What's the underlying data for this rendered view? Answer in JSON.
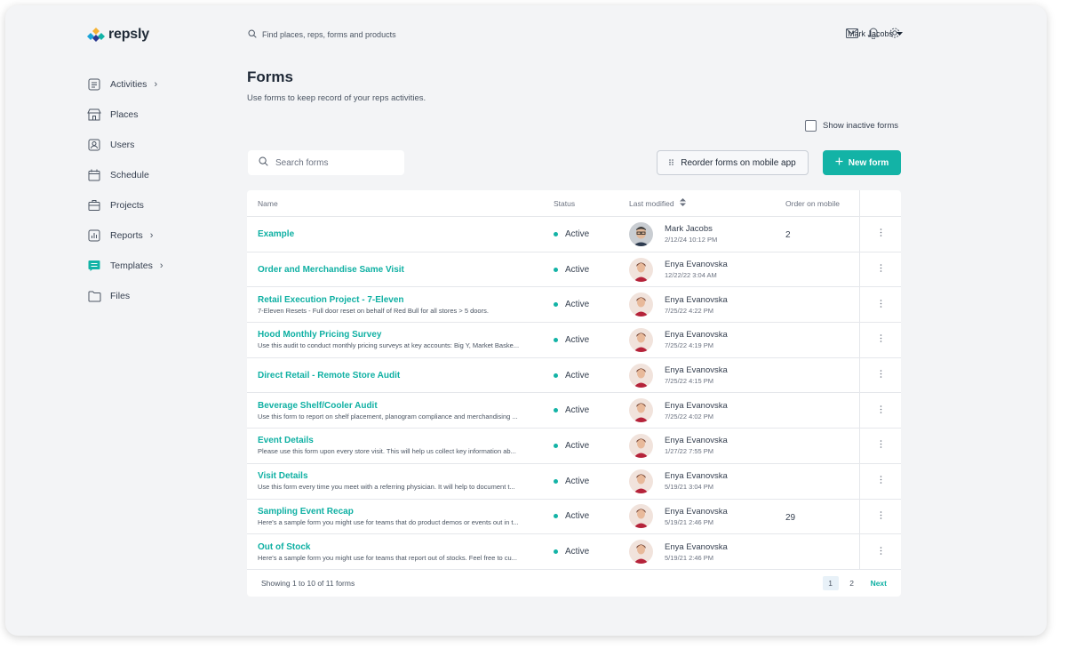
{
  "brand": {
    "name": "repsly"
  },
  "topbar": {
    "search_placeholder": "Find places, reps, forms and products",
    "user_name": "Mark Jacobs",
    "icons": [
      "mail-icon",
      "bell-icon",
      "gear-icon"
    ]
  },
  "sidebar": {
    "items": [
      {
        "label": "Activities",
        "icon": "activities-icon",
        "has_chevron": true
      },
      {
        "label": "Places",
        "icon": "store-icon",
        "has_chevron": false
      },
      {
        "label": "Users",
        "icon": "user-icon",
        "has_chevron": false
      },
      {
        "label": "Schedule",
        "icon": "calendar-icon",
        "has_chevron": false
      },
      {
        "label": "Projects",
        "icon": "briefcase-icon",
        "has_chevron": false
      },
      {
        "label": "Reports",
        "icon": "report-icon",
        "has_chevron": true
      },
      {
        "label": "Templates",
        "icon": "template-icon",
        "has_chevron": true,
        "active": true
      },
      {
        "label": "Files",
        "icon": "folder-icon",
        "has_chevron": false
      }
    ]
  },
  "page": {
    "title": "Forms",
    "subtitle": "Use forms to keep record of your reps activities.",
    "show_inactive_label": "Show inactive forms",
    "search_placeholder": "Search forms",
    "reorder_label": "Reorder forms on mobile app",
    "new_form_label": "New form"
  },
  "table": {
    "headers": {
      "name": "Name",
      "status": "Status",
      "modified": "Last modified",
      "order": "Order on mobile"
    },
    "rows": [
      {
        "name": "Example",
        "desc": "",
        "status": "Active",
        "user": "Mark Jacobs",
        "date": "2/12/24 10:12 PM",
        "order": "2",
        "avatar": "mark"
      },
      {
        "name": "Order and Merchandise Same Visit",
        "desc": "",
        "status": "Active",
        "user": "Enya Evanovska",
        "date": "12/22/22 3:04 AM",
        "order": "",
        "avatar": "enya"
      },
      {
        "name": "Retail Execution Project - 7-Eleven",
        "desc": "7-Eleven Resets - Full door reset on behalf of Red Bull for all stores > 5 doors.",
        "status": "Active",
        "user": "Enya Evanovska",
        "date": "7/25/22 4:22 PM",
        "order": "",
        "avatar": "enya"
      },
      {
        "name": "Hood Monthly Pricing Survey",
        "desc": "Use this audit to conduct monthly pricing surveys at key accounts: Big Y, Market Baske...",
        "status": "Active",
        "user": "Enya Evanovska",
        "date": "7/25/22 4:19 PM",
        "order": "",
        "avatar": "enya"
      },
      {
        "name": "Direct Retail - Remote Store Audit",
        "desc": "",
        "status": "Active",
        "user": "Enya Evanovska",
        "date": "7/25/22 4:15 PM",
        "order": "",
        "avatar": "enya"
      },
      {
        "name": "Beverage Shelf/Cooler Audit",
        "desc": "Use this form to report on shelf placement, planogram compliance and merchandising ...",
        "status": "Active",
        "user": "Enya Evanovska",
        "date": "7/25/22 4:02 PM",
        "order": "",
        "avatar": "enya"
      },
      {
        "name": "Event Details",
        "desc": "Please use this form upon every store visit. This will help us collect key information ab...",
        "status": "Active",
        "user": "Enya Evanovska",
        "date": "1/27/22 7:55 PM",
        "order": "",
        "avatar": "enya"
      },
      {
        "name": "Visit Details",
        "desc": "Use this form every time you meet with a referring physician. It will help to document t...",
        "status": "Active",
        "user": "Enya Evanovska",
        "date": "5/19/21 3:04 PM",
        "order": "",
        "avatar": "enya"
      },
      {
        "name": "Sampling Event Recap",
        "desc": "Here's a sample form you might use for teams that do product demos or events out in t...",
        "status": "Active",
        "user": "Enya Evanovska",
        "date": "5/19/21 2:46 PM",
        "order": "29",
        "avatar": "enya"
      },
      {
        "name": "Out of Stock",
        "desc": "Here's a sample form you might use for teams that report out of stocks. Feel free to cu...",
        "status": "Active",
        "user": "Enya Evanovska",
        "date": "5/19/21 2:46 PM",
        "order": "",
        "avatar": "enya"
      }
    ],
    "footer": {
      "showing": "Showing 1 to 10 of 11 forms",
      "pages": [
        "1",
        "2"
      ],
      "current_page": "1",
      "next_label": "Next"
    }
  },
  "colors": {
    "accent": "#13b3a6",
    "link": "#0fb0a3",
    "background": "#f3f4f6"
  }
}
